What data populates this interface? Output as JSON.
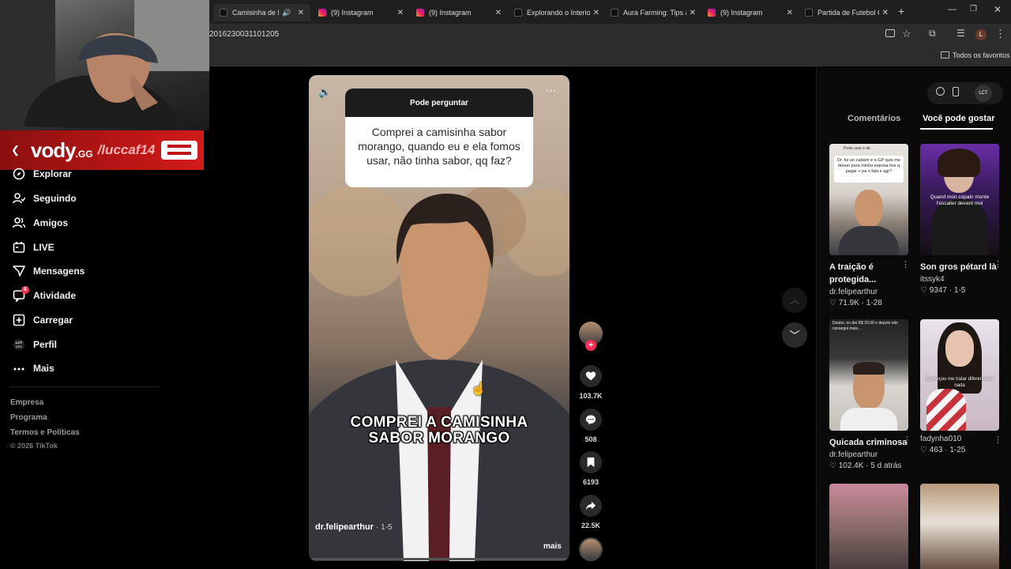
{
  "browser": {
    "tabs": [
      {
        "label": "Camisinha de Mo",
        "type": "tiktok",
        "active": true
      },
      {
        "label": "(9) Instagram",
        "type": "instagram",
        "active": false
      },
      {
        "label": "(9) Instagram",
        "type": "instagram",
        "active": false
      },
      {
        "label": "Explorando o Interior",
        "type": "tiktok",
        "active": false
      },
      {
        "label": "Aura Farming: Tips an",
        "type": "tiktok",
        "active": false
      },
      {
        "label": "(9) Instagram",
        "type": "instagram",
        "active": false
      },
      {
        "label": "Partida de Futebol G",
        "type": "tiktok",
        "active": false
      }
    ],
    "url_fragment": "2016230031101205",
    "bookmarks_label": "Todos os favoritos",
    "profile_initial": "L"
  },
  "stream_overlay": {
    "brand": "vody",
    "brand_suffix": ".GG",
    "handle": "/luccaf14"
  },
  "sidebar": {
    "items": [
      {
        "label": "Explorar",
        "icon": "compass-icon"
      },
      {
        "label": "Seguindo",
        "icon": "following-icon"
      },
      {
        "label": "Amigos",
        "icon": "friends-icon"
      },
      {
        "label": "LIVE",
        "icon": "live-icon"
      },
      {
        "label": "Mensagens",
        "icon": "messages-icon"
      },
      {
        "label": "Atividade",
        "icon": "activity-icon",
        "badge": "8"
      },
      {
        "label": "Carregar",
        "icon": "upload-icon"
      },
      {
        "label": "Perfil",
        "icon": "profile-icon"
      },
      {
        "label": "Mais",
        "icon": "more-icon"
      }
    ],
    "footer": [
      "Empresa",
      "Programa",
      "Termos e Políticas",
      "© 2026 TikTok"
    ]
  },
  "video": {
    "question_header": "Pode perguntar",
    "question_text": "Comprei a camisinha sabor morango, quando eu e ela fomos usar, não tinha sabor, qq faz?",
    "caption_line1": "COMPREI A CAMISINHA",
    "caption_line2": "SABOR MORANGO",
    "author": "dr.felipearthur",
    "date": "· 1-5",
    "more_label": "mais"
  },
  "actions": {
    "likes": "103.7K",
    "comments": "508",
    "saves": "6193",
    "shares": "22.5K"
  },
  "right_panel": {
    "tabs": [
      "Comentários",
      "Você pode gostar"
    ],
    "active_tab": "Você pode gostar",
    "cards": [
      {
        "title": "A traição é protegida...",
        "user": "dr.felipearthur",
        "likes": "71.9K",
        "date": "1-28",
        "thumb_text": "Dr, fui ao cabaré e a GP quis me denun para minha esposa tive q pagar + pa n fala e agr?",
        "thumb_header": "Pode usar e ab"
      },
      {
        "title": "Son gros pétard là",
        "user": "itssyk4",
        "likes": "9347",
        "date": "1-5",
        "thumb_text": "Quand mon copain monte l'escalier devant moi"
      },
      {
        "title": "Quicada criminosa",
        "user": "dr.felipearthur",
        "likes": "102.4K",
        "date": "5 d atrás",
        "thumb_text": "Doutor, eu dei R$ 20,00 e depois não consegui mais..."
      },
      {
        "title": "",
        "user": "fadynha010",
        "likes": "463",
        "date": "1-25",
        "thumb_text": "Começou me tratar diferente do nada"
      }
    ]
  }
}
